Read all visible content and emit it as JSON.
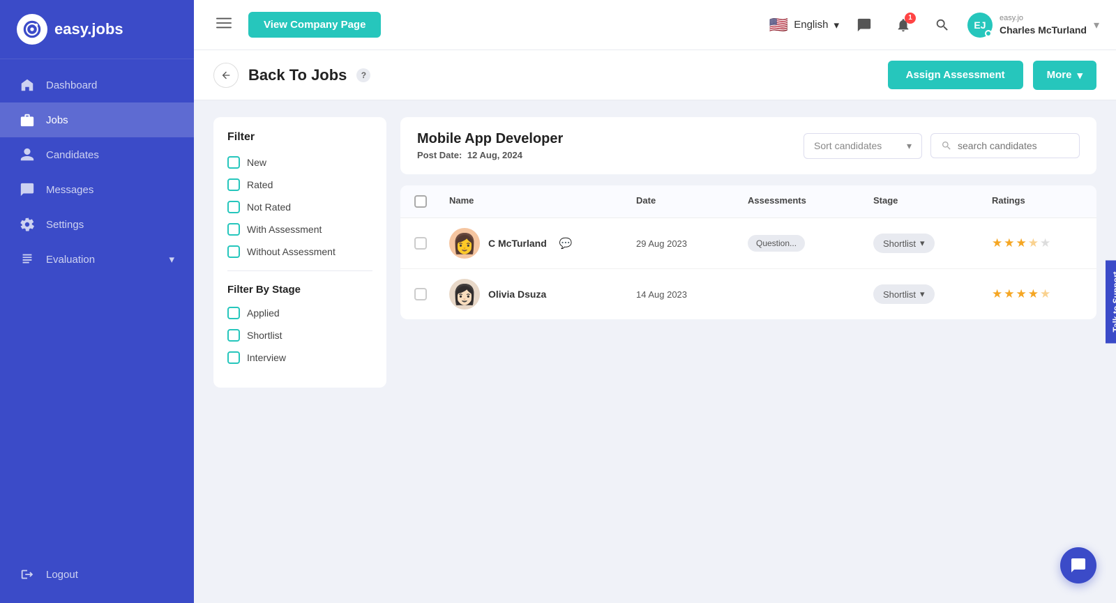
{
  "sidebar": {
    "logo_text": "easy.jobs",
    "items": [
      {
        "id": "dashboard",
        "label": "Dashboard",
        "active": false
      },
      {
        "id": "jobs",
        "label": "Jobs",
        "active": true
      },
      {
        "id": "candidates",
        "label": "Candidates",
        "active": false
      },
      {
        "id": "messages",
        "label": "Messages",
        "active": false
      },
      {
        "id": "settings",
        "label": "Settings",
        "active": false
      },
      {
        "id": "evaluation",
        "label": "Evaluation",
        "active": false,
        "has_chevron": true
      }
    ],
    "logout_label": "Logout"
  },
  "topbar": {
    "menu_icon": "☰",
    "view_company_btn": "View Company Page",
    "language": "English",
    "notification_count": "1",
    "user": {
      "company": "easy.jo",
      "name": "Charles McTurland"
    }
  },
  "subheader": {
    "back_label": "Back To Jobs",
    "help_icon": "?",
    "assign_btn": "Assign Assessment",
    "more_btn": "More"
  },
  "job": {
    "title": "Mobile App Developer",
    "post_date_label": "Post Date:",
    "post_date": "12 Aug, 2024"
  },
  "sort_placeholder": "Sort candidates",
  "search_placeholder": "search candidates",
  "table": {
    "headers": [
      "",
      "Name",
      "Date",
      "Assessments",
      "Stage",
      "Ratings"
    ],
    "rows": [
      {
        "id": 1,
        "name": "C McTurland",
        "avatar_emoji": "👩",
        "date": "29 Aug 2023",
        "assessment": "Question...",
        "stage": "Shortlist",
        "stars": [
          1,
          1,
          1,
          0.5,
          0
        ]
      },
      {
        "id": 2,
        "name": "Olivia Dsuza",
        "avatar_emoji": "👩🏻",
        "date": "14 Aug 2023",
        "assessment": "",
        "stage": "Shortlist",
        "stars": [
          1,
          1,
          1,
          1,
          0.5
        ]
      }
    ]
  },
  "filter": {
    "title": "Filter",
    "items": [
      {
        "label": "New"
      },
      {
        "label": "Rated"
      },
      {
        "label": "Not Rated"
      },
      {
        "label": "With Assessment"
      },
      {
        "label": "Without Assessment"
      }
    ],
    "stage_title": "Filter By Stage",
    "stage_items": [
      {
        "label": "Applied"
      },
      {
        "label": "Shortlist"
      },
      {
        "label": "Interview"
      }
    ]
  },
  "talk_support": "Talk to Support",
  "chat_bubble_icon": "💬"
}
